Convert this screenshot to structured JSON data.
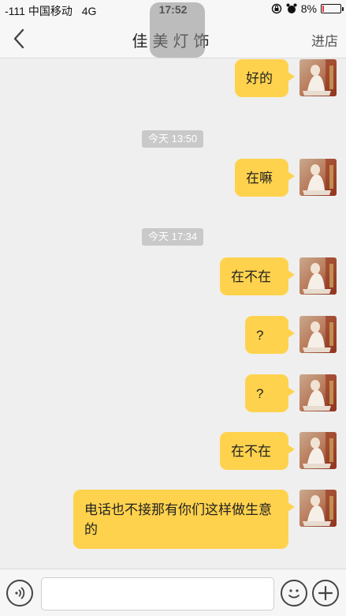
{
  "status_bar": {
    "signal": "-111 中国移动",
    "network": "4G",
    "time": "17:52",
    "battery_percent": "8%",
    "battery_level": 0.08
  },
  "nav": {
    "title": "佳美灯饰",
    "right_action": "进店"
  },
  "messages": [
    {
      "type": "text",
      "text": "好的",
      "from": "me"
    },
    {
      "type": "time",
      "text": "今天 13:50"
    },
    {
      "type": "text",
      "text": "在嘛",
      "from": "me"
    },
    {
      "type": "time",
      "text": "今天 17:34"
    },
    {
      "type": "text",
      "text": "在不在",
      "from": "me"
    },
    {
      "type": "text",
      "text": "?",
      "from": "me"
    },
    {
      "type": "text",
      "text": "?",
      "from": "me"
    },
    {
      "type": "text",
      "text": "在不在",
      "from": "me"
    },
    {
      "type": "text",
      "text": "电话也不接那有你们这样做生意的",
      "from": "me"
    }
  ],
  "input": {
    "value": "",
    "placeholder": ""
  },
  "icons": {
    "back": "chevron-left-icon",
    "voice": "voice-icon",
    "emoji": "emoji-icon",
    "plus": "plus-icon"
  }
}
